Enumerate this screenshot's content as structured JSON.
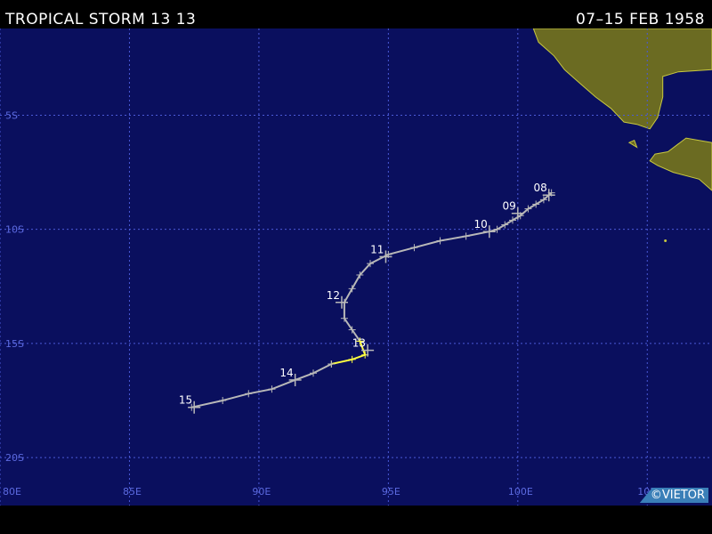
{
  "header": {
    "storm_name": "TROPICAL STORM 13 13",
    "date_range": "07–15 FEB 1958"
  },
  "map": {
    "lon_range": [
      80,
      107.5
    ],
    "lat_range": [
      -1.2,
      -22.1
    ],
    "lat_gridlines": [
      -5,
      -10,
      -15,
      -20
    ],
    "lat_labels": [
      "5S",
      "10S",
      "15S",
      "20S"
    ],
    "lon_gridlines": [
      80,
      85,
      90,
      95,
      100,
      105
    ],
    "lon_labels": [
      "80E",
      "85E",
      "90E",
      "95E",
      "100E",
      "105E"
    ],
    "colors": {
      "ocean": "#0a0f5e",
      "grid": "#4a5ad8",
      "grid_label": "#5c6ae0",
      "land": "#6b6b22",
      "coast": "#c8c840",
      "track_depression": "#b8b8b8",
      "track_storm": "#ffff40",
      "day_label": "#ffffff"
    }
  },
  "track": {
    "day_labels": [
      {
        "label": "08",
        "lon": 101.2,
        "lat": -8.5
      },
      {
        "label": "09",
        "lon": 100.0,
        "lat": -9.3
      },
      {
        "label": "10",
        "lon": 98.9,
        "lat": -10.1
      },
      {
        "label": "11",
        "lon": 94.9,
        "lat": -11.2
      },
      {
        "label": "12",
        "lon": 93.2,
        "lat": -13.2
      },
      {
        "label": "13",
        "lon": 94.2,
        "lat": -15.3
      },
      {
        "label": "14",
        "lon": 91.4,
        "lat": -16.6
      },
      {
        "label": "15",
        "lon": 87.5,
        "lat": -17.8
      }
    ],
    "segments": [
      {
        "intensity": "depression",
        "points": [
          [
            101.3,
            -8.4
          ],
          [
            101.0,
            -8.7
          ],
          [
            100.7,
            -8.9
          ],
          [
            100.4,
            -9.1
          ],
          [
            100.1,
            -9.4
          ],
          [
            99.8,
            -9.6
          ],
          [
            99.5,
            -9.8
          ],
          [
            99.2,
            -10.0
          ],
          [
            98.9,
            -10.1
          ],
          [
            98.0,
            -10.3
          ],
          [
            97.0,
            -10.5
          ],
          [
            96.0,
            -10.8
          ],
          [
            95.0,
            -11.1
          ],
          [
            94.3,
            -11.5
          ],
          [
            93.9,
            -12.0
          ],
          [
            93.6,
            -12.6
          ],
          [
            93.3,
            -13.2
          ],
          [
            93.3,
            -13.9
          ],
          [
            93.6,
            -14.4
          ],
          [
            93.9,
            -14.9
          ]
        ]
      },
      {
        "intensity": "storm",
        "points": [
          [
            93.9,
            -14.9
          ],
          [
            94.1,
            -15.5
          ],
          [
            93.6,
            -15.7
          ],
          [
            92.8,
            -15.9
          ]
        ]
      },
      {
        "intensity": "depression",
        "points": [
          [
            92.8,
            -15.9
          ],
          [
            92.1,
            -16.3
          ],
          [
            91.4,
            -16.6
          ],
          [
            90.5,
            -17.0
          ],
          [
            89.6,
            -17.2
          ],
          [
            88.6,
            -17.5
          ],
          [
            87.4,
            -17.8
          ]
        ]
      }
    ]
  },
  "watermark": "©VIETOR"
}
